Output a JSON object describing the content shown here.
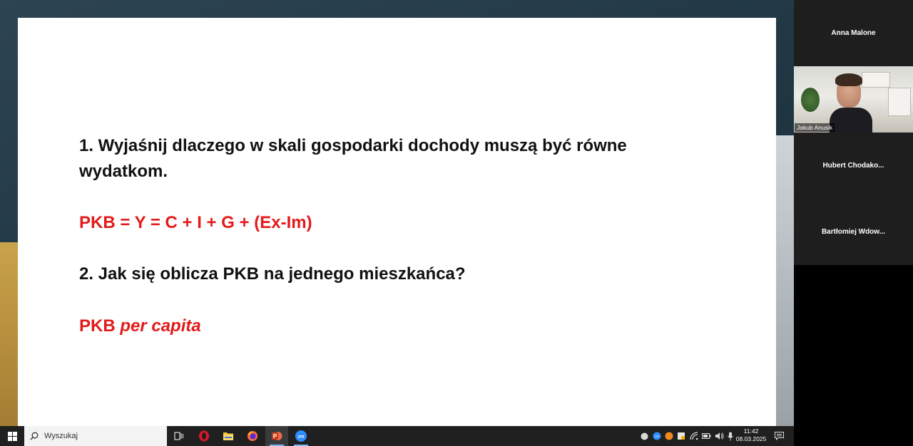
{
  "slide": {
    "q1_line1": "1. Wyjaśnij dlaczego w skali gospodarki dochody muszą być równe",
    "q1_line2": "wydatkom.",
    "a1": "PKB = Y = C + I + G + (Ex-Im)",
    "q2": "2. Jak się oblicza PKB na jednego mieszkańca?",
    "a2_main": "PKB",
    "a2_italic": "per capita"
  },
  "participants": [
    {
      "name": "Anna Malone",
      "video": false
    },
    {
      "name": "Jakub Anusik",
      "video": true
    },
    {
      "name": "Hubert  Chodako...",
      "video": false
    },
    {
      "name": "Bartłomiej  Wdow...",
      "video": false
    }
  ],
  "taskbar": {
    "search_placeholder": "Wyszukaj",
    "apps": [
      "task-view",
      "opera",
      "file-explorer",
      "firefox",
      "powerpoint",
      "zoom"
    ],
    "time": "11:42",
    "date": "08.03.2025"
  },
  "colors": {
    "answer_red": "#e31b1b",
    "question_black": "#111111"
  }
}
